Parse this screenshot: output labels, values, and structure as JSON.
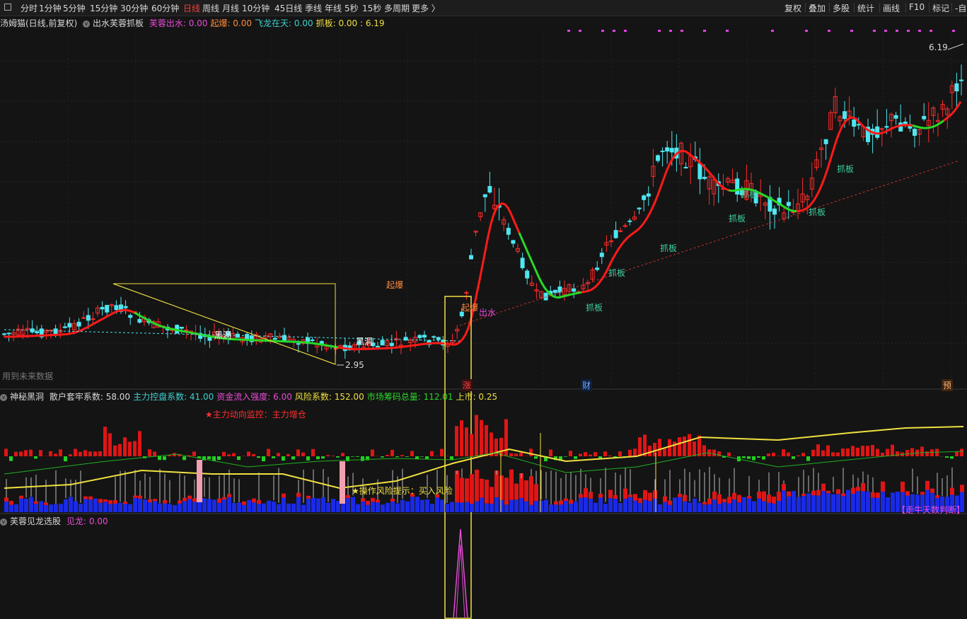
{
  "toolbar": {
    "left_icon": "panel-toggle-icon",
    "periods": [
      "分时",
      "1分钟",
      "5分钟",
      "15分钟",
      "30分钟",
      "60分钟",
      "日线",
      "周线",
      "月线",
      "10分钟",
      "45日线",
      "季线",
      "年线",
      "5秒",
      "15秒",
      "多周期",
      "更多 〉"
    ],
    "active_period": "日线",
    "right_items": [
      "复权",
      "叠加",
      "多股",
      "统计",
      "画线",
      "F10",
      "标记",
      "-自"
    ]
  },
  "main_pane": {
    "stock_title": "汤姆猫(日线,前复权)",
    "indicator_name": "出水芙蓉抓板",
    "indicators": [
      {
        "label": "芙蓉出水:",
        "value": "0.00",
        "color": "#e84bd8"
      },
      {
        "label": "起爆:",
        "value": "0.00",
        "color": "#ff8a3d"
      },
      {
        "label": "飞龙在天:",
        "value": "0.00",
        "color": "#3fd0d0"
      },
      {
        "label": "抓板:",
        "value": "0.00 : 6.19",
        "color": "#f0e040"
      }
    ],
    "high_label": "6.19",
    "low_label": "2.95",
    "future_data_note": "用到未来数据",
    "annotations": {
      "qibao": "起爆",
      "chushui": "出水",
      "qibao2": "起爆",
      "heidong1": "黑洞",
      "heidong2": "黑洞",
      "zhuaban": "抓板"
    },
    "bottom_markers": [
      "涨",
      "财",
      "预"
    ],
    "colors": {
      "up": "#ff2b2b",
      "down": "#4ee6f0",
      "ma": "#ff1a1a",
      "ma_green": "#26d926",
      "yellow": "#f0e040"
    }
  },
  "mid_pane": {
    "indicator_name": "神秘黑洞",
    "values": [
      {
        "label": "散户套牢系数:",
        "value": "58.00",
        "color": "#d8d8d8"
      },
      {
        "label": "主力控盘系数:",
        "value": "41.00",
        "color": "#3fd0d0"
      },
      {
        "label": "资金流入强度:",
        "value": "6.00",
        "color": "#e84bd8"
      },
      {
        "label": "风险系数:",
        "value": "152.00",
        "color": "#f0e040"
      },
      {
        "label": "市场筹码总量:",
        "value": "112.01",
        "color": "#26d926"
      },
      {
        "label": "上市:",
        "value": "0.25",
        "color": "#f0e040"
      }
    ],
    "monitor_text": "★主力动向监控：主力增仓",
    "risk_text": "★操作风险提示：买入风险",
    "trend_text": "【走牛天数判断】"
  },
  "bottom_pane": {
    "indicator_name": "芙蓉见龙选股",
    "value_label": "见龙:",
    "value": "0.00"
  }
}
